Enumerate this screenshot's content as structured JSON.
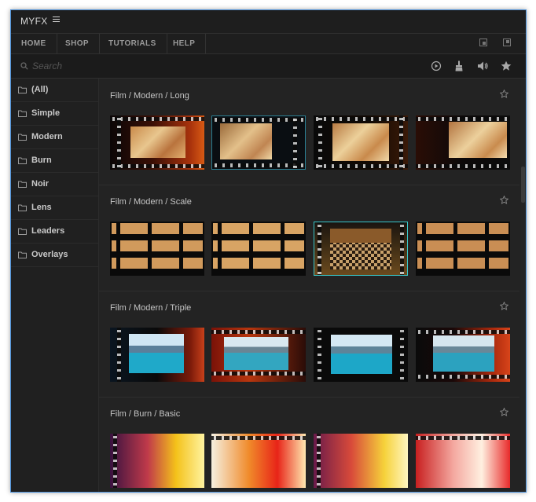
{
  "app": {
    "title": "MYFX"
  },
  "nav": {
    "items": [
      "HOME",
      "SHOP",
      "TUTORIALS",
      "HELP"
    ]
  },
  "search": {
    "placeholder": "Search",
    "value": ""
  },
  "toolbar": {
    "icons": [
      "play-icon",
      "brush-icon",
      "volume-icon",
      "star-icon"
    ]
  },
  "sidebar": {
    "items": [
      {
        "label": "(All)"
      },
      {
        "label": "Simple"
      },
      {
        "label": "Modern"
      },
      {
        "label": "Burn"
      },
      {
        "label": "Noir"
      },
      {
        "label": "Lens"
      },
      {
        "label": "Leaders"
      },
      {
        "label": "Overlays"
      }
    ]
  },
  "sections": [
    {
      "title": "Film / Modern / Long",
      "thumbs": 4,
      "selected": -1
    },
    {
      "title": "Film / Modern / Scale",
      "thumbs": 4,
      "selected": 2
    },
    {
      "title": "Film / Modern / Triple",
      "thumbs": 4,
      "selected": -1
    },
    {
      "title": "Film / Burn / Basic",
      "thumbs": 4,
      "selected": -1
    }
  ],
  "colors": {
    "accent": "#38c6c9",
    "window_border": "#4a90d9",
    "background": "#232323"
  }
}
